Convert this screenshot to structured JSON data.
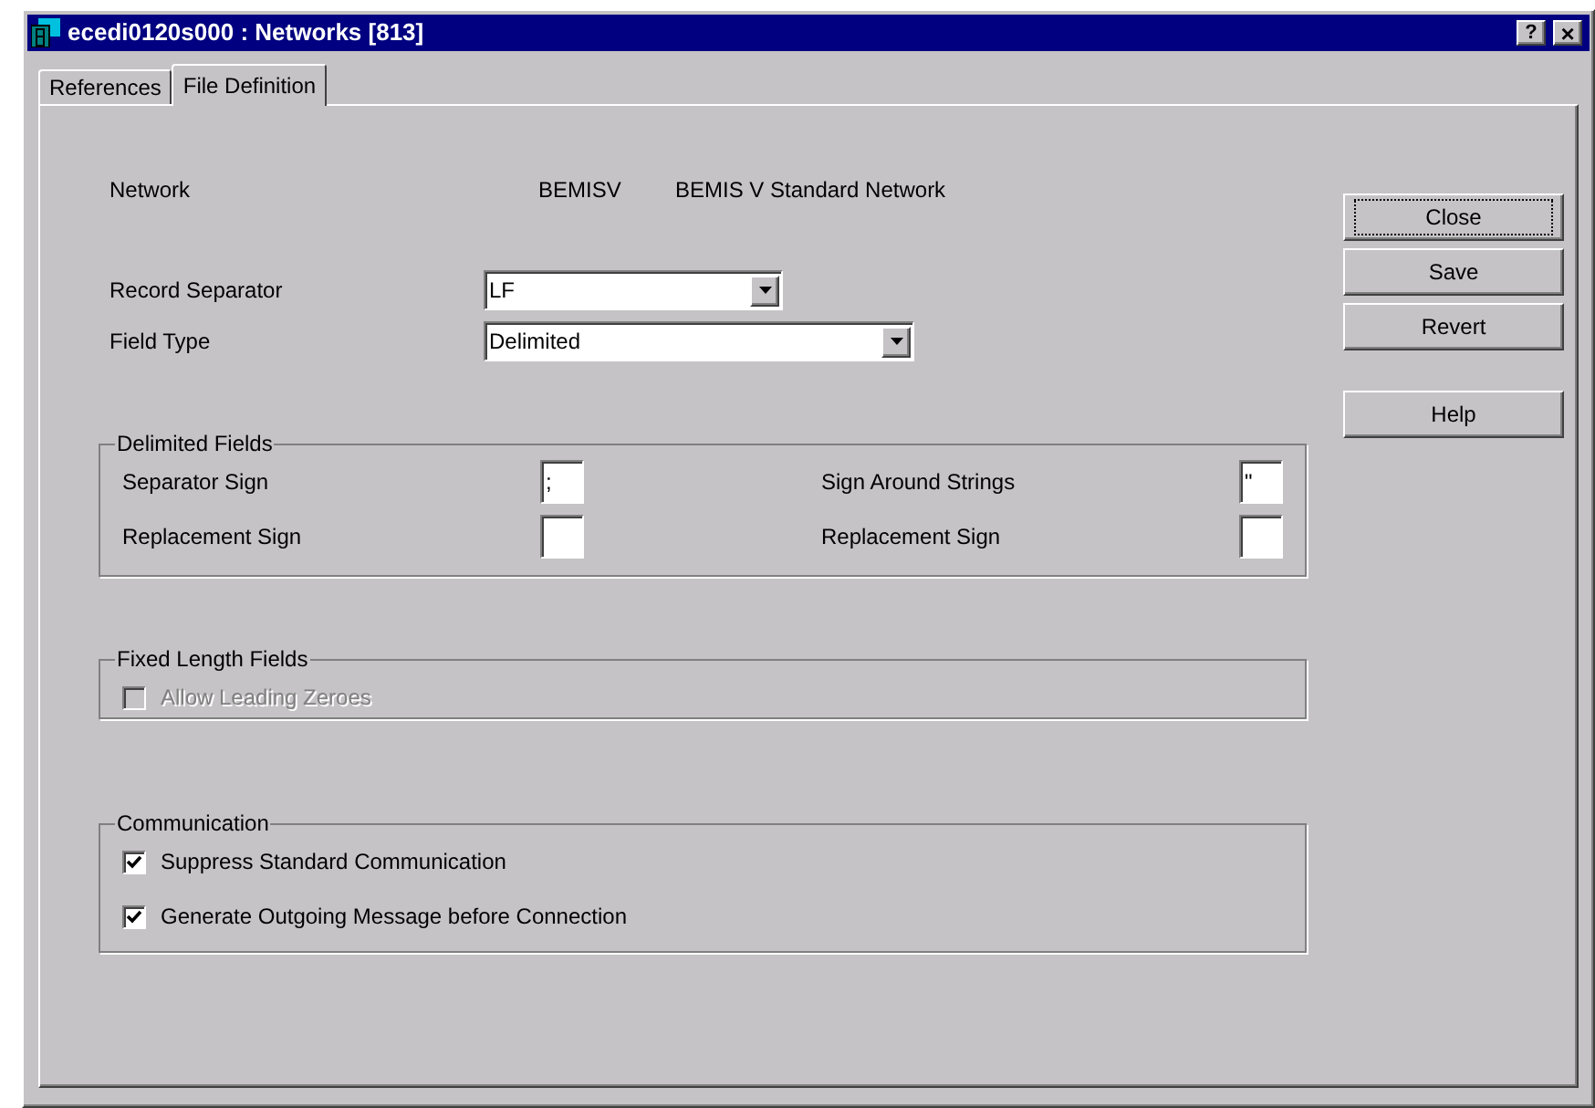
{
  "window": {
    "title": "ecedi0120s000 : Networks [813]",
    "help_button": "?",
    "close_button": "×"
  },
  "tabs": [
    {
      "label": "References",
      "selected": false
    },
    {
      "label": "File Definition",
      "selected": true
    }
  ],
  "network": {
    "label": "Network",
    "code": "BEMISV",
    "description": "BEMIS V Standard Network"
  },
  "dropdowns": [
    {
      "label": "Record Separator",
      "value": "LF",
      "wide": false
    },
    {
      "label": "Field Type",
      "value": "Delimited",
      "wide": true
    }
  ],
  "delimited_fields": {
    "title": "Delimited Fields",
    "fields": [
      {
        "label": "Separator Sign",
        "value": ";"
      },
      {
        "label": "Sign Around Strings",
        "value": "\""
      },
      {
        "label": "Replacement Sign"
      },
      {
        "label": "Replacement Sign"
      }
    ]
  },
  "fixed_length_fields": {
    "title": "Fixed Length Fields",
    "options": [
      {
        "label": "Allow Leading Zeroes",
        "checked": false,
        "disabled": true
      }
    ]
  },
  "communication": {
    "title": "Communication",
    "options": [
      {
        "label": "Suppress Standard Communication",
        "checked": true,
        "disabled": false
      },
      {
        "label": "Generate Outgoing Message before Connection",
        "checked": true,
        "disabled": false
      }
    ]
  },
  "button_groups": [
    [
      {
        "label": "Close",
        "focused": true
      },
      {
        "label": "Save",
        "focused": false
      },
      {
        "label": "Revert",
        "focused": false
      }
    ],
    [
      {
        "label": "Help",
        "focused": false
      }
    ]
  ]
}
